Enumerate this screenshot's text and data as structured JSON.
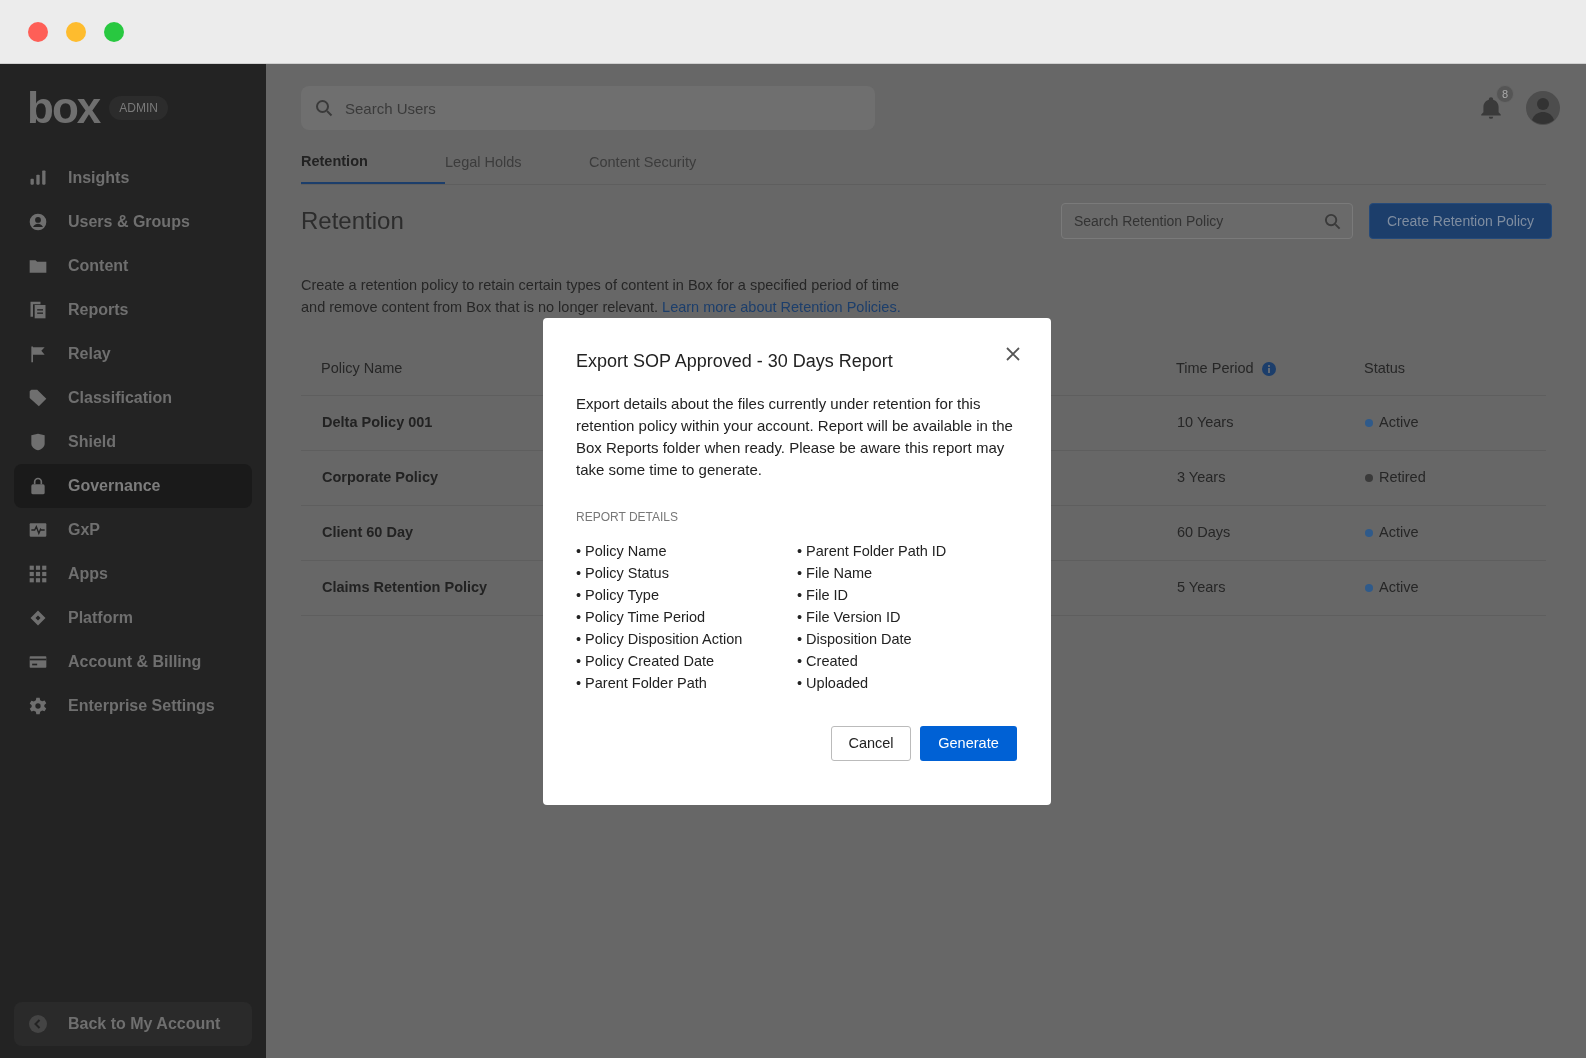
{
  "brand": {
    "logo": "box",
    "badge": "ADMIN"
  },
  "sidebar": {
    "items": [
      {
        "label": "Insights",
        "selected": false
      },
      {
        "label": "Users & Groups",
        "selected": false
      },
      {
        "label": "Content",
        "selected": false
      },
      {
        "label": "Reports",
        "selected": false
      },
      {
        "label": "Relay",
        "selected": false
      },
      {
        "label": "Classification",
        "selected": false
      },
      {
        "label": "Shield",
        "selected": false
      },
      {
        "label": "Governance",
        "selected": true
      },
      {
        "label": "GxP",
        "selected": false
      },
      {
        "label": "Apps",
        "selected": false
      },
      {
        "label": "Platform",
        "selected": false
      },
      {
        "label": "Account & Billing",
        "selected": false
      },
      {
        "label": "Enterprise Settings",
        "selected": false
      }
    ],
    "footer": "Back to My Account"
  },
  "header": {
    "search": {
      "placeholder": "Search Users"
    },
    "notifications": "8"
  },
  "tabs": [
    {
      "label": "Retention",
      "selected": true
    },
    {
      "label": "Legal Holds",
      "selected": false
    },
    {
      "label": "Content Security",
      "selected": false
    }
  ],
  "page": {
    "title": "Retention",
    "search": {
      "placeholder": "Search Retention Policy"
    },
    "create_button": "Create Retention Policy",
    "description": "Create a retention policy to retain certain types of content in Box for a specified period of time and remove content from Box that is no longer relevant.",
    "link": "Learn more about Retention Policies."
  },
  "table": {
    "columns": [
      "Policy Name",
      "Time Period",
      "Status"
    ],
    "rows": [
      {
        "name": "Delta Policy 001",
        "period": "10 Years",
        "status": "Active",
        "color": "#2f5a8a"
      },
      {
        "name": "Corporate Policy",
        "period": "3 Years",
        "status": "Retired",
        "color": "#3a3a3a"
      },
      {
        "name": "Client 60 Day",
        "period": "60 Days",
        "status": "Active",
        "color": "#2f5a8a"
      },
      {
        "name": "Claims Retention Policy",
        "period": "5 Years",
        "status": "Active",
        "color": "#2f5a8a"
      }
    ]
  },
  "dialog": {
    "title": "Export SOP Approved - 30 Days Report",
    "body": "Export details about the files currently under retention for this retention policy within your account. Report will be available in the Box Reports folder when ready. Please be aware this report may take some time to generate.",
    "section": "REPORT DETAILS",
    "details_left": [
      "• Policy Name",
      "• Policy Status",
      "• Policy Type",
      "• Policy Time Period",
      "• Policy Disposition Action",
      "• Policy Created Date",
      "• Parent Folder Path"
    ],
    "details_right": [
      "• Parent Folder Path ID",
      "• File Name",
      "• File ID",
      "• File Version ID",
      "• Disposition Date",
      "• Created",
      "• Uploaded"
    ],
    "buttons": {
      "cancel": "Cancel",
      "primary": "Generate"
    }
  }
}
